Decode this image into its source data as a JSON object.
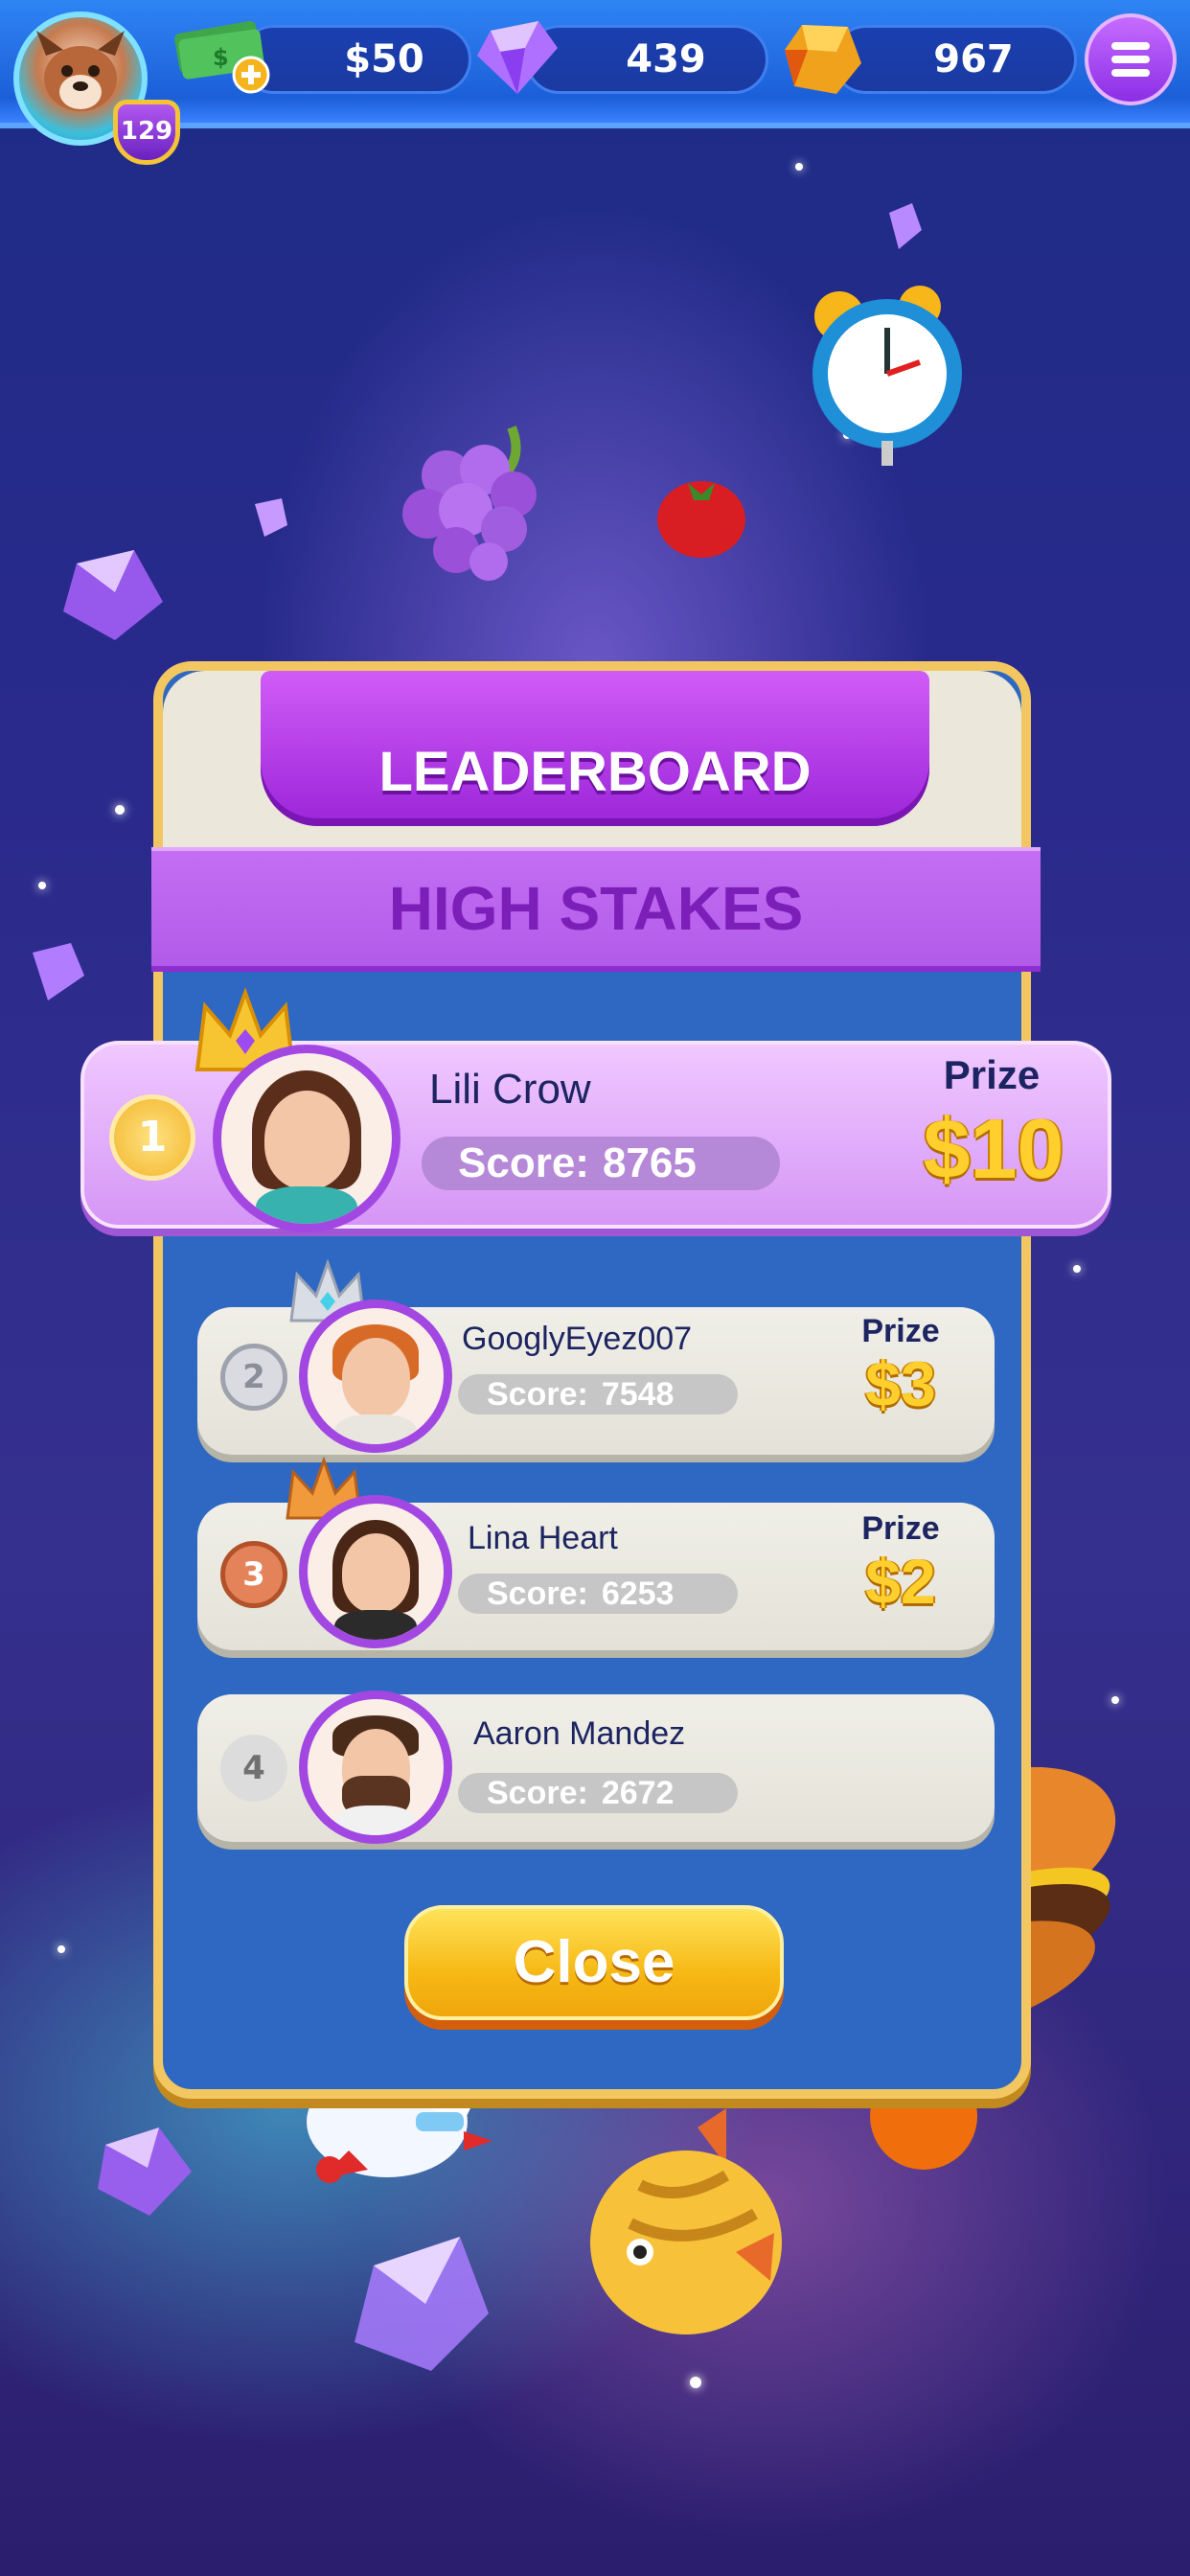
{
  "hud": {
    "player_level": "129",
    "cash": "$50",
    "gems": "439",
    "coins": "967"
  },
  "leaderboard": {
    "title": "LEADERBOARD",
    "subtitle": "HIGH STAKES",
    "score_label": "Score:",
    "prize_label": "Prize",
    "entries": [
      {
        "rank": "1",
        "name": "Lili Crow",
        "score": "8765",
        "prize": "$10"
      },
      {
        "rank": "2",
        "name": "GooglyEyez007",
        "score": "7548",
        "prize": "$3"
      },
      {
        "rank": "3",
        "name": "Lina Heart",
        "score": "6253",
        "prize": "$2"
      },
      {
        "rank": "4",
        "name": "Aaron Mandez",
        "score": "2672"
      }
    ],
    "close_label": "Close"
  },
  "icons": {
    "menu": "hamburger-menu-icon",
    "cash": "cash-plus-icon",
    "gem": "purple-gem-icon",
    "coin": "gold-coin-icon"
  },
  "colors": {
    "accent_purple": "#a347e3",
    "gold": "#ffcf2e",
    "panel_blue": "#2f68c2",
    "close_button": "#f6b814"
  }
}
